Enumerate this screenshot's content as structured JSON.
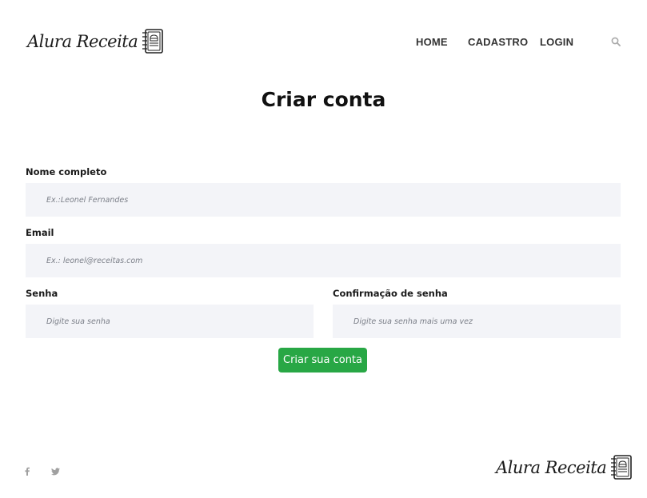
{
  "header": {
    "logo_text": "Alura Receita",
    "nav": [
      {
        "label": "HOME"
      },
      {
        "label": "CADASTRO"
      },
      {
        "label": "LOGIN"
      }
    ],
    "search_icon": "search-icon"
  },
  "page": {
    "title": "Criar conta"
  },
  "form": {
    "nome": {
      "label": "Nome completo",
      "value": "",
      "placeholder": "Ex.:Leonel Fernandes"
    },
    "email": {
      "label": "Email",
      "value": "",
      "placeholder": "Ex.: leonel@receitas.com"
    },
    "senha": {
      "label": "Senha",
      "value": "",
      "placeholder": "Digite sua senha"
    },
    "confirmacao": {
      "label": "Confirmação de senha",
      "value": "",
      "placeholder": "Digite sua senha mais uma vez"
    },
    "submit_label": "Criar sua conta"
  },
  "footer": {
    "social": [
      "facebook-icon",
      "twitter-icon"
    ],
    "logo_text": "Alura Receita"
  },
  "colors": {
    "accent": "#28a745",
    "input_bg": "#f3f4f8"
  }
}
